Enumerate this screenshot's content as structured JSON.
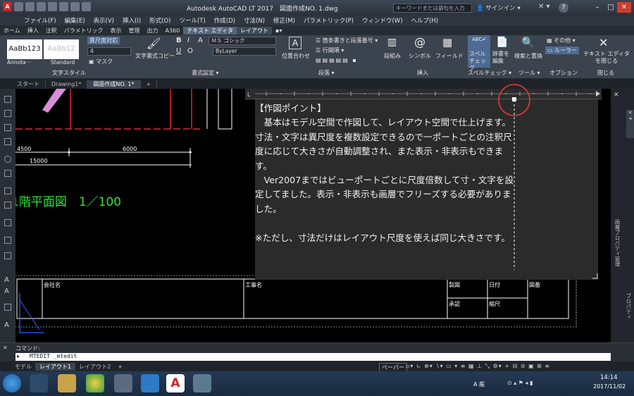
{
  "titlebar": {
    "app_title": "Autodesk AutoCAD LT 2017　図面作成NO. 1.dwg",
    "search_placeholder": "キーワードまたは語句を入力",
    "signin": "サインイン",
    "help": "?"
  },
  "menus": [
    "ファイル(F)",
    "編集(E)",
    "表示(V)",
    "挿入(I)",
    "形式(O)",
    "ツール(T)",
    "作成(D)",
    "寸法(N)",
    "修正(M)",
    "パラメトリック(P)",
    "ウィンドウ(W)",
    "ヘルプ(H)"
  ],
  "ribbon_tabs": [
    "ホーム",
    "挿入",
    "注釈",
    "パラメトリック",
    "表示",
    "管理",
    "出力",
    "A360",
    "テキスト エディタ",
    "レイアウト"
  ],
  "ribbon": {
    "text_style_label": "文字スタイル",
    "style1": "AaBb123",
    "style2": "AaBb12",
    "annotative_btn": "異尺度対応",
    "height_value": "4",
    "mask_btn": "マスク",
    "annota_name": "Annota···",
    "standard_name": "Standard",
    "match_btn": "文字書式コピー",
    "font_value": "ＭＳ ゴシック",
    "color_value": "ByLayer",
    "format_label": "書式設定 ▾",
    "justify_btn": "位置合わせ",
    "bullets_btn": "箇条書きと段落番号 ▾",
    "linespace_btn": "行間隔 ▾",
    "paragraph_label": "段落 ▾",
    "columns_btn": "段組み",
    "symbol_btn": "シンボル",
    "field_btn": "フィールド",
    "insert_label": "挿入",
    "spell_btn": "スペルチェック",
    "dict_btn": "辞書を編集",
    "spell_label": "スペルチェック ▾",
    "find_btn": "検索と置換",
    "tools_label": "ツール ▾",
    "other_btn": "その他 ▾",
    "ruler_btn": "ルーラー",
    "options_label": "オプション",
    "close_btn": "テキスト エディタを閉じる",
    "close_label": "閉じる"
  },
  "doc_tabs": [
    "スタート",
    "Drawing1*",
    "図面作成NO. 1*",
    "+"
  ],
  "drawing": {
    "dim1": "4500",
    "dim2": "6000",
    "dim3": "15000",
    "plan_title": "1階平面図　1／100",
    "tb_company": "会社名",
    "tb_project": "工事名",
    "tb_drawn": "製図",
    "tb_date": "日付",
    "tb_drawno": "図番",
    "tb_approved": "承認",
    "tb_scale": "縮尺"
  },
  "editor": {
    "text": "【作図ポイント】\n　基本はモデル空間で作図して、レイアウト空間で仕上げます。寸法・文字は異尺度を複数設定できるので一ポートごとの注釈尺度に応じて大きさが自動調整され、また表示・非表示もできます。\n　Ver2007まではビューポートごとに尺度倍数して寸・文字を設定してました。表示・非表示も画層でフリーズする必要がありました。\n\n※ただし、寸法だけはレイアウト尺度を使えば同じ大きさです。"
  },
  "right_panel": {
    "label1": "画層プロパティ管理",
    "label2": "プロパティ"
  },
  "command": {
    "prompt_label": "コマンド:",
    "history": "MTEDIT _mtedit"
  },
  "layout_tabs": [
    "モデル",
    "レイアウト1",
    "レイアウト2",
    "+"
  ],
  "status": {
    "paper": "ペーパー"
  },
  "taskbar": {
    "time": "14:14",
    "date": "2017/11/02",
    "ime": "A 般"
  },
  "colors": {
    "highlight_circle": "#e03a3a",
    "plan_title": "#33e03a",
    "wall_red": "#e0282e"
  }
}
